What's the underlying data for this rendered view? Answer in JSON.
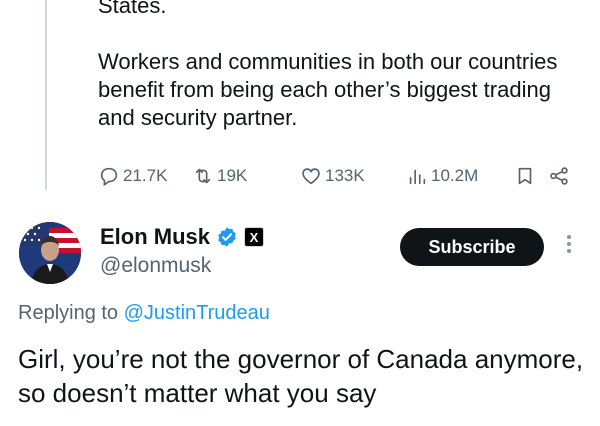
{
  "parent_tweet": {
    "text_lines": [
      "States.",
      "Workers and communities in both our countries benefit from being each other’s biggest trading and security partner."
    ],
    "metrics": {
      "replies": "21.7K",
      "retweets": "19K",
      "likes": "133K",
      "views": "10.2M"
    }
  },
  "reply_tweet": {
    "author_name": "Elon Musk",
    "handle": "@elonmusk",
    "affiliation_badge": "X",
    "subscribe_label": "Subscribe",
    "replying_prefix": "Replying to",
    "replying_to": "@JustinTrudeau",
    "text": "Girl, you’re not the governor of Canada anymore, so doesn’t matter what you say"
  },
  "colors": {
    "text": "#0f1419",
    "secondary": "#536471",
    "accent": "#1d9bf0",
    "button_bg": "#0f1419"
  },
  "icons": {
    "reply": "reply-icon",
    "retweet": "retweet-icon",
    "like": "heart-icon",
    "views": "views-icon",
    "bookmark": "bookmark-icon",
    "share": "share-icon",
    "verified": "verified-badge-icon",
    "more": "more-options-icon"
  }
}
